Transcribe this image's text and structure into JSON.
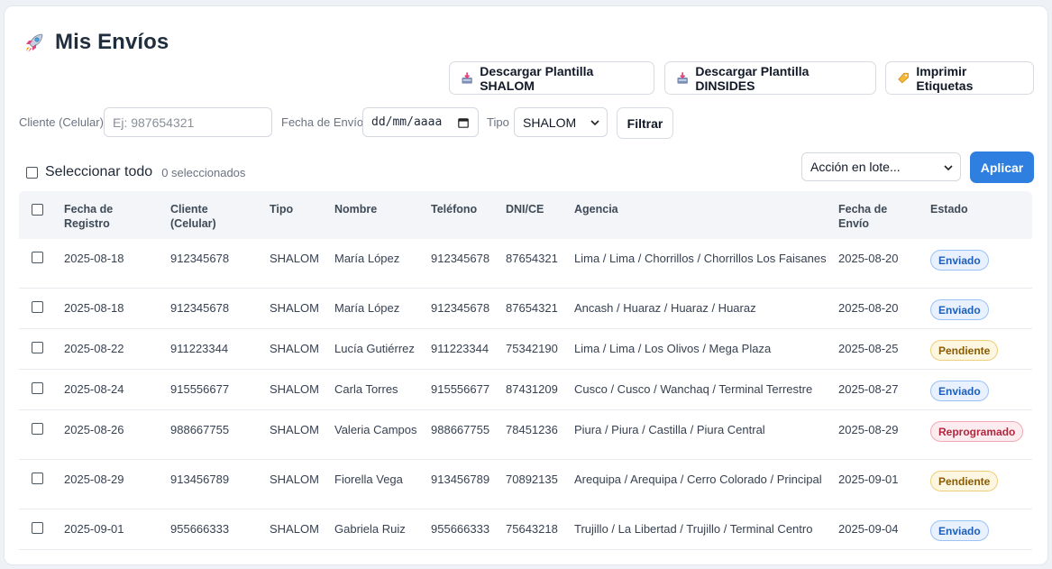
{
  "page": {
    "title": "Mis Envíos",
    "title_icon": "rocket-icon"
  },
  "toolbar": {
    "download_shalom": "Descargar Plantilla SHALOM",
    "download_dinsides": "Descargar Plantilla DINSIDES",
    "print_labels": "Imprimir Etiquetas"
  },
  "filters": {
    "client_label": "Cliente (Celular)",
    "client_placeholder": "Ej: 987654321",
    "date_label": "Fecha de Envío",
    "date_placeholder": "dd/mm/aaaa",
    "type_label": "Tipo",
    "type_value": "SHALOM",
    "filter_button": "Filtrar"
  },
  "bulk": {
    "select_all": "Seleccionar todo",
    "selected_count": "0 seleccionados",
    "action_placeholder": "Acción en lote...",
    "apply": "Aplicar"
  },
  "table": {
    "headers": {
      "registro": "Fecha de Registro",
      "cliente": "Cliente (Celular)",
      "tipo": "Tipo",
      "nombre": "Nombre",
      "telefono": "Teléfono",
      "dni": "DNI/CE",
      "agencia": "Agencia",
      "envio": "Fecha de Envío",
      "estado": "Estado"
    },
    "rows": [
      {
        "registro": "2025-08-18",
        "cliente": "912345678",
        "tipo": "SHALOM",
        "nombre": "María López",
        "telefono": "912345678",
        "dni": "87654321",
        "agencia": "Lima / Lima / Chorrillos / Chorrillos Los Faisanes",
        "envio": "2025-08-20",
        "estado": "Enviado"
      },
      {
        "registro": "2025-08-18",
        "cliente": "912345678",
        "tipo": "SHALOM",
        "nombre": "María López",
        "telefono": "912345678",
        "dni": "87654321",
        "agencia": "Ancash / Huaraz / Huaraz / Huaraz",
        "envio": "2025-08-20",
        "estado": "Enviado"
      },
      {
        "registro": "2025-08-22",
        "cliente": "911223344",
        "tipo": "SHALOM",
        "nombre": "Lucía Gutiérrez",
        "telefono": "911223344",
        "dni": "75342190",
        "agencia": "Lima / Lima / Los Olivos / Mega Plaza",
        "envio": "2025-08-25",
        "estado": "Pendiente"
      },
      {
        "registro": "2025-08-24",
        "cliente": "915556677",
        "tipo": "SHALOM",
        "nombre": "Carla Torres",
        "telefono": "915556677",
        "dni": "87431209",
        "agencia": "Cusco / Cusco / Wanchaq / Terminal Terrestre",
        "envio": "2025-08-27",
        "estado": "Enviado"
      },
      {
        "registro": "2025-08-26",
        "cliente": "988667755",
        "tipo": "SHALOM",
        "nombre": "Valeria Campos",
        "telefono": "988667755",
        "dni": "78451236",
        "agencia": "Piura / Piura / Castilla / Piura Central",
        "envio": "2025-08-29",
        "estado": "Reprogramado"
      },
      {
        "registro": "2025-08-29",
        "cliente": "913456789",
        "tipo": "SHALOM",
        "nombre": "Fiorella Vega",
        "telefono": "913456789",
        "dni": "70892135",
        "agencia": "Arequipa / Arequipa / Cerro Colorado / Principal",
        "envio": "2025-09-01",
        "estado": "Pendiente"
      },
      {
        "registro": "2025-09-01",
        "cliente": "955666333",
        "tipo": "SHALOM",
        "nombre": "Gabriela Ruiz",
        "telefono": "955666333",
        "dni": "75643218",
        "agencia": "Trujillo / La Libertad / Trujillo / Terminal Centro",
        "envio": "2025-09-04",
        "estado": "Enviado"
      }
    ]
  },
  "status_colors": {
    "Enviado": {
      "bg": "#e8f1fd",
      "border": "#9cc2f2",
      "text": "#1d5fb8"
    },
    "Pendiente": {
      "bg": "#fdf6e1",
      "border": "#edcf7a",
      "text": "#8a5a00"
    },
    "Reprogramado": {
      "bg": "#fdecef",
      "border": "#f1a9b5",
      "text": "#b2263f"
    }
  }
}
